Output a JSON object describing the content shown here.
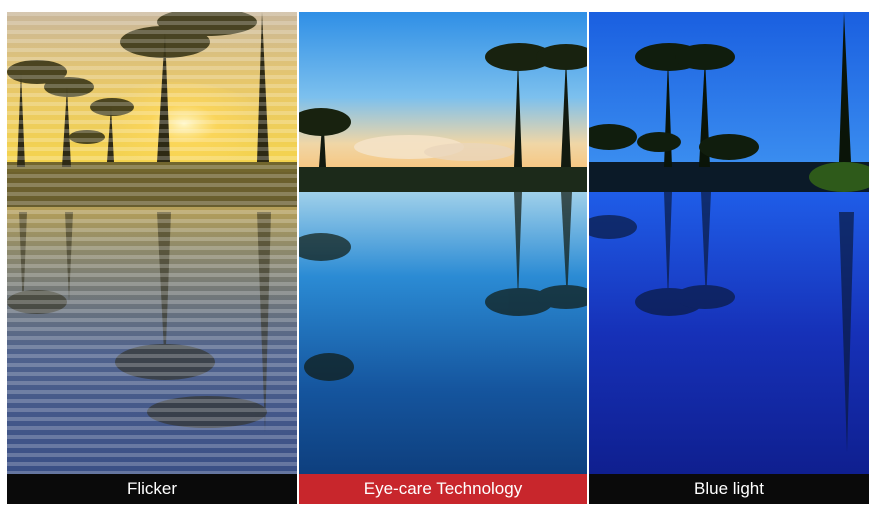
{
  "panels": [
    {
      "id": "flicker",
      "label": "Flicker",
      "label_bg": "#0a0a0a"
    },
    {
      "id": "eye-care",
      "label": "Eye-care Technology",
      "label_bg": "#c8262c"
    },
    {
      "id": "blue-light",
      "label": "Blue light",
      "label_bg": "#0a0a0a"
    }
  ],
  "colors": {
    "label_text": "#ffffff",
    "highlight": "#c8262c"
  }
}
